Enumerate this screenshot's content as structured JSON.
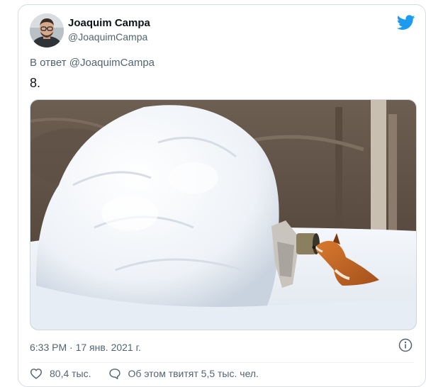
{
  "tweet": {
    "author_name": "Joaquim Campa",
    "author_handle": "@JoaquimCampa",
    "reply_prefix": "В ответ",
    "reply_mention": "@JoaquimCampa",
    "text": "8.",
    "timestamp": "6:33 PM · 17 янв. 2021 г.",
    "likes": "80,4 тыс.",
    "discussion": "Об этом твитят 5,5 тыс. чел."
  },
  "icons": {
    "brand": "twitter-bird-icon",
    "info": "info-icon",
    "like": "heart-icon",
    "comment": "speech-bubble-icon"
  },
  "colors": {
    "brand": "#1d9bf0",
    "secondary_text": "#536471",
    "primary_text": "#0f1419"
  }
}
